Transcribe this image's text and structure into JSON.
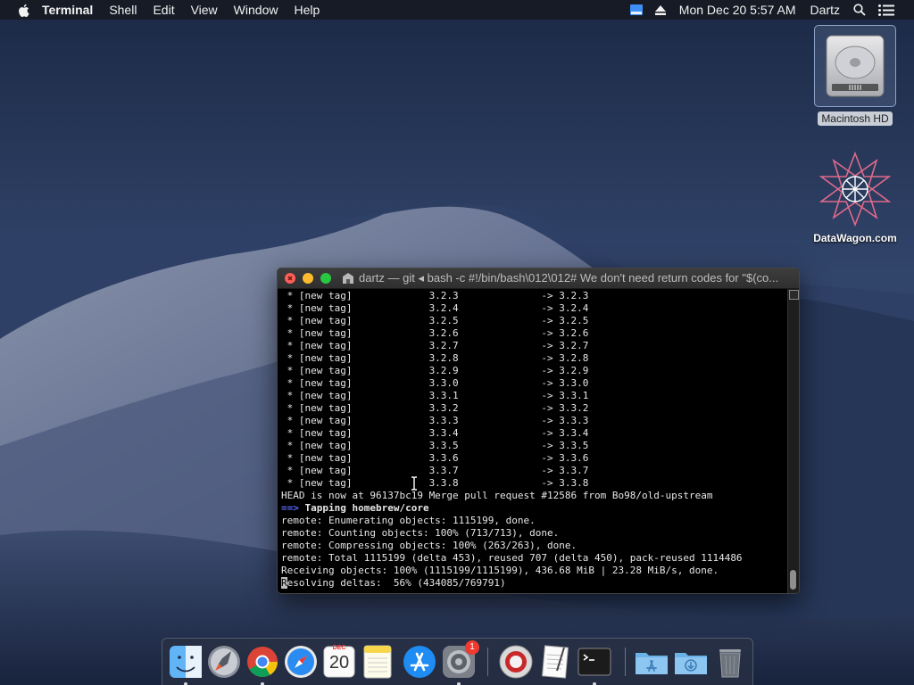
{
  "menubar": {
    "app_name": "Terminal",
    "menus": [
      "Shell",
      "Edit",
      "View",
      "Window",
      "Help"
    ],
    "clock": "Mon Dec 20  5:57 AM",
    "user": "Dartz"
  },
  "desktop": {
    "icons": [
      {
        "label": "Macintosh HD"
      },
      {
        "label": "DataWagon.com"
      }
    ]
  },
  "terminal": {
    "title": "dartz — git ◂ bash -c #!/bin/bash\\012\\012# We don't need return codes for \"$(co...",
    "lines": [
      " * [new tag]             3.2.3              -> 3.2.3",
      " * [new tag]             3.2.4              -> 3.2.4",
      " * [new tag]             3.2.5              -> 3.2.5",
      " * [new tag]             3.2.6              -> 3.2.6",
      " * [new tag]             3.2.7              -> 3.2.7",
      " * [new tag]             3.2.8              -> 3.2.8",
      " * [new tag]             3.2.9              -> 3.2.9",
      " * [new tag]             3.3.0              -> 3.3.0",
      " * [new tag]             3.3.1              -> 3.3.1",
      " * [new tag]             3.3.2              -> 3.3.2",
      " * [new tag]             3.3.3              -> 3.3.3",
      " * [new tag]             3.3.4              -> 3.3.4",
      " * [new tag]             3.3.5              -> 3.3.5",
      " * [new tag]             3.3.6              -> 3.3.6",
      " * [new tag]             3.3.7              -> 3.3.7",
      " * [new tag]             3.3.8              -> 3.3.8",
      "HEAD is now at 96137bc19 Merge pull request #12586 from Bo98/old-upstream"
    ],
    "tap_arrow": "==>",
    "tap_text": " Tapping homebrew/core",
    "remote_lines": [
      "remote: Enumerating objects: 1115199, done.",
      "remote: Counting objects: 100% (713/713), done.",
      "remote: Compressing objects: 100% (263/263), done.",
      "remote: Total 1115199 (delta 453), reused 707 (delta 450), pack-reused 1114486",
      "Receiving objects: 100% (1115199/1115199), 436.68 MiB | 23.28 MiB/s, done."
    ],
    "last_line_cursor_char": "R",
    "last_line_rest": "esolving deltas:  56% (434085/769791)"
  },
  "dock": {
    "calendar_month": "DEC",
    "calendar_day": "20",
    "badge_count": "1",
    "items": [
      {
        "name": "finder"
      },
      {
        "name": "launchpad"
      },
      {
        "name": "chrome"
      },
      {
        "name": "safari"
      },
      {
        "name": "calendar"
      },
      {
        "name": "notes"
      },
      {
        "name": "app-store"
      },
      {
        "name": "system-preferences"
      },
      {
        "name": "photo-booth"
      },
      {
        "name": "textedit"
      },
      {
        "name": "terminal"
      },
      {
        "name": "applications-folder"
      },
      {
        "name": "downloads-folder"
      },
      {
        "name": "trash"
      }
    ]
  },
  "colors": {
    "accent_prompt": "#5b6cff",
    "close": "#fc5f57",
    "minimize": "#fdbc2e",
    "zoom": "#28c840"
  }
}
